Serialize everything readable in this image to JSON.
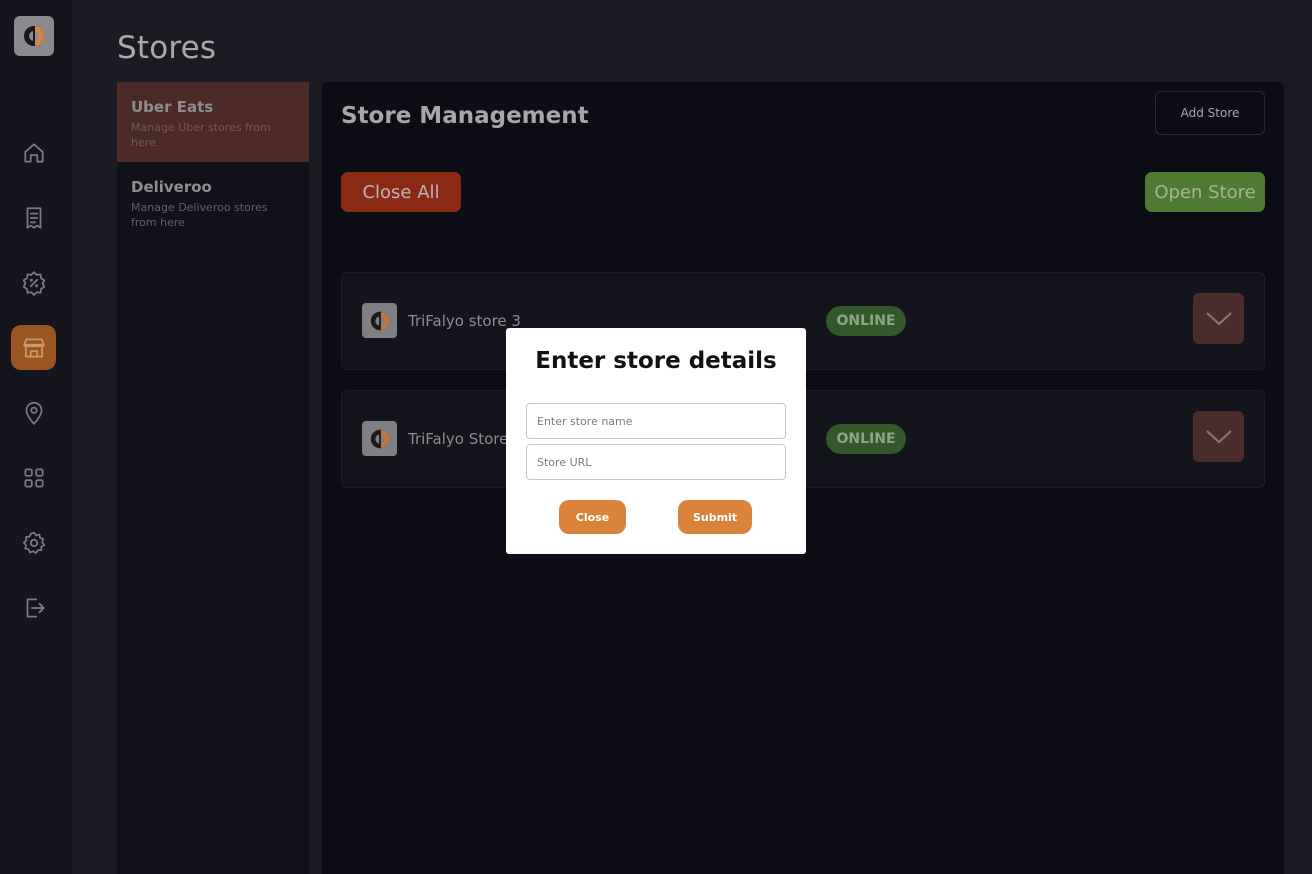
{
  "colors": {
    "rail_active": "#9a5620",
    "close_all": "#8b2915",
    "open_store": "#4f7a34",
    "status_online": "#33592a",
    "modal_button": "#d9833d"
  },
  "rail": {
    "logo": "brand-logo-icon",
    "items": [
      {
        "icon": "home-icon",
        "active": false
      },
      {
        "icon": "receipt-icon",
        "active": false
      },
      {
        "icon": "discount-badge-icon",
        "active": false
      },
      {
        "icon": "store-icon",
        "active": true
      },
      {
        "icon": "location-pin-icon",
        "active": false
      },
      {
        "icon": "grid-icon",
        "active": false
      },
      {
        "icon": "gear-icon",
        "active": false
      },
      {
        "icon": "logout-icon",
        "active": false
      }
    ]
  },
  "page": {
    "title": "Stores"
  },
  "platforms": [
    {
      "name": "Uber Eats",
      "description": "Manage Uber stores from here",
      "active": true
    },
    {
      "name": "Deliveroo",
      "description": "Manage Deliveroo stores from here",
      "active": false
    }
  ],
  "main": {
    "title": "Store Management",
    "add_store_label": "Add Store",
    "close_all_label": "Close All",
    "open_store_label": "Open Store",
    "stores": [
      {
        "name": "TriFalyo store 3",
        "status": "ONLINE"
      },
      {
        "name": "TriFalyo Store",
        "status": "ONLINE"
      }
    ]
  },
  "modal": {
    "title": "Enter store details",
    "name_input": {
      "value": "",
      "placeholder": "Enter store name"
    },
    "url_input": {
      "value": "",
      "placeholder": "Store URL"
    },
    "close_label": "Close",
    "submit_label": "Submit"
  }
}
